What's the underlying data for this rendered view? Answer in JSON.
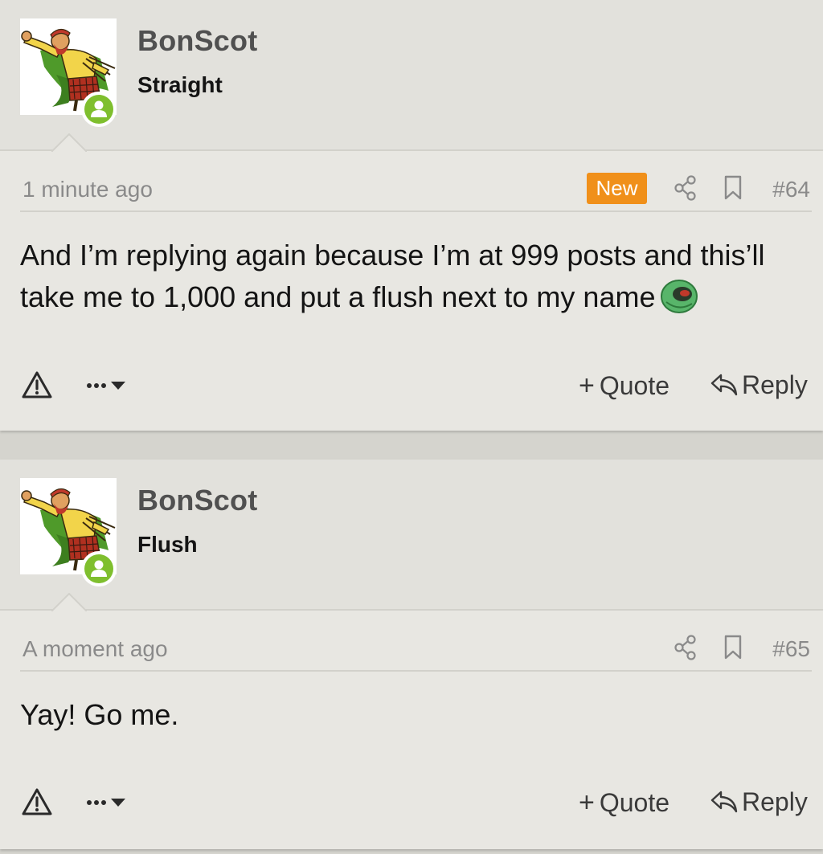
{
  "posts": [
    {
      "author": "BonScot",
      "user_title": "Straight",
      "timestamp": "1 minute ago",
      "new_badge": "New",
      "post_number": "#64",
      "content": "And I’m replying again because I’m at 999 posts and this’ll take me to 1,000 and put a flush next to my name",
      "quote_label": "Quote",
      "reply_label": "Reply"
    },
    {
      "author": "BonScot",
      "user_title": "Flush",
      "timestamp": "A moment ago",
      "post_number": "#65",
      "content": "Yay! Go me.",
      "quote_label": "Quote",
      "reply_label": "Reply"
    }
  ],
  "colors": {
    "new_badge": "#f0901a",
    "online_badge": "#7fbf2e",
    "post_background": "#e8e7e2",
    "header_background": "#e2e1dc"
  },
  "icons": [
    "avatar-image",
    "online-status-icon",
    "share-icon",
    "bookmark-icon",
    "report-icon",
    "more-options-icon",
    "reply-icon",
    "smiley-icon"
  ]
}
